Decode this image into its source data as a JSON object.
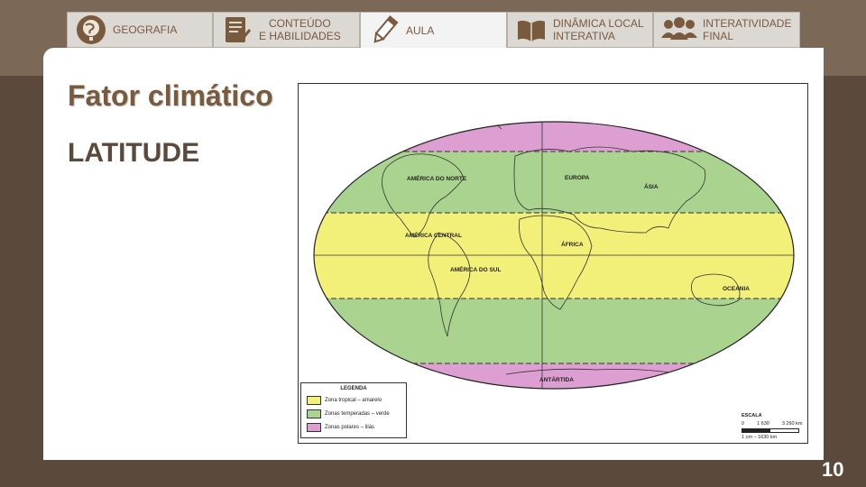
{
  "tabs": [
    {
      "label_1": "GEOGRAFIA",
      "label_2": "",
      "icon": "globe-icon"
    },
    {
      "label_1": "CONTEÚDO",
      "label_2": "E HABILIDADES",
      "icon": "checklist-icon"
    },
    {
      "label_1": "AULA",
      "label_2": "",
      "icon": "pencil-icon"
    },
    {
      "label_1": "DINÂMICA LOCAL",
      "label_2": "INTERATIVA",
      "icon": "book-icon"
    },
    {
      "label_1": "INTERATIVIDADE",
      "label_2": "FINAL",
      "icon": "people-icon"
    }
  ],
  "slide": {
    "title": "Fator climático",
    "subtitle": "LATITUDE",
    "page_number": "10"
  },
  "map": {
    "labels": {
      "north_america": "AMÉRICA DO NORTE",
      "central_america": "AMÉRICA CENTRAL",
      "south_america": "AMÉRICA DO SUL",
      "europe": "EUROPA",
      "asia": "ÁSIA",
      "africa": "ÁFRICA",
      "oceania": "OCEANIA",
      "antarctica": "ANTÁRTIDA"
    },
    "legend": {
      "title": "LEGENDA",
      "items": [
        {
          "label": "Zona tropical – amarelo",
          "color": "#f3f07a"
        },
        {
          "label": "Zonas temperadas – verde",
          "color": "#a9d38e"
        },
        {
          "label": "Zonas polares – lilás",
          "color": "#dd9fd1"
        }
      ]
    },
    "scale": {
      "title": "ESCALA",
      "ticks": [
        "0",
        "1 630",
        "3 260 km"
      ],
      "ratio": "1 cm – 1630 km"
    }
  },
  "colors": {
    "header_bg": "#7c6856",
    "page_bg": "#5b4a3b",
    "tab_bg": "#dcd8d3",
    "tab_text": "#7a5a3c",
    "tropical": "#f3f07a",
    "temperate": "#a9d38e",
    "polar": "#dd9fd1"
  }
}
